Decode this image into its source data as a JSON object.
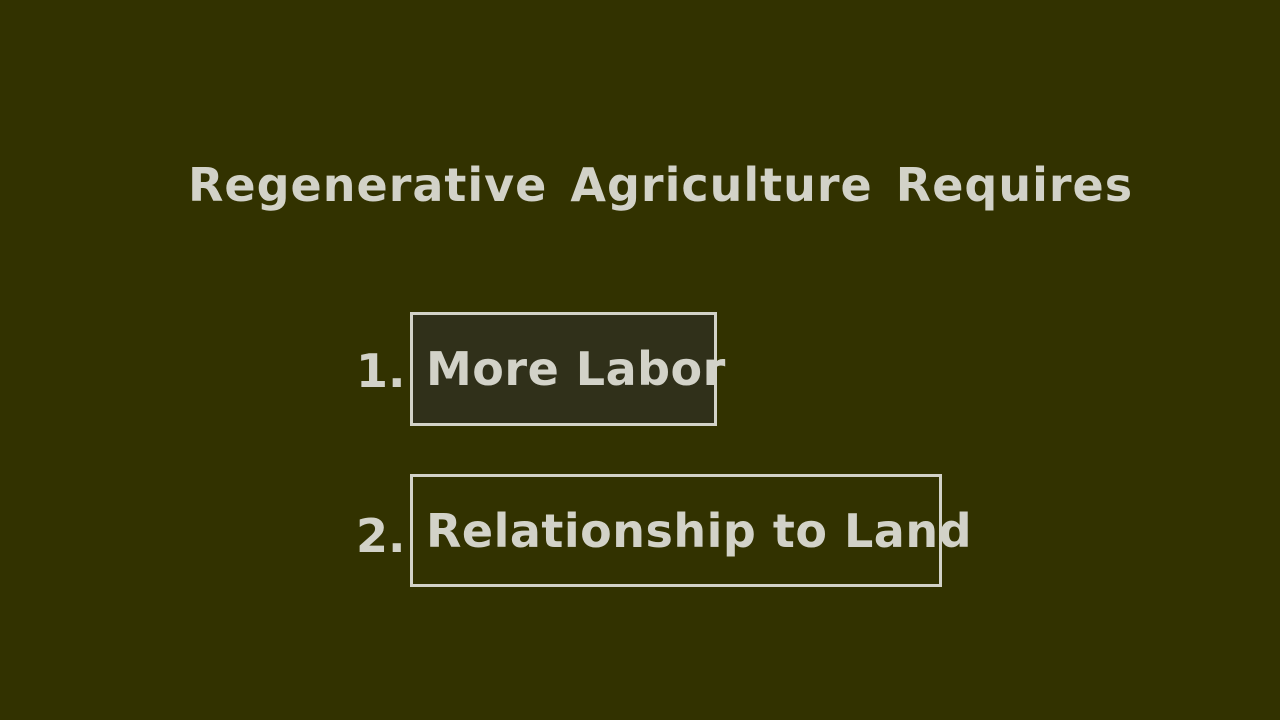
{
  "slide": {
    "title": "Regenerative Agriculture Requires",
    "items": [
      {
        "number": "1.",
        "label": "More Labor"
      },
      {
        "number": "2.",
        "label": "Relationship to Land"
      }
    ]
  },
  "colors": {
    "background": "#323200",
    "text": "#d2d2c8",
    "box_border": "#d2d2c8"
  }
}
